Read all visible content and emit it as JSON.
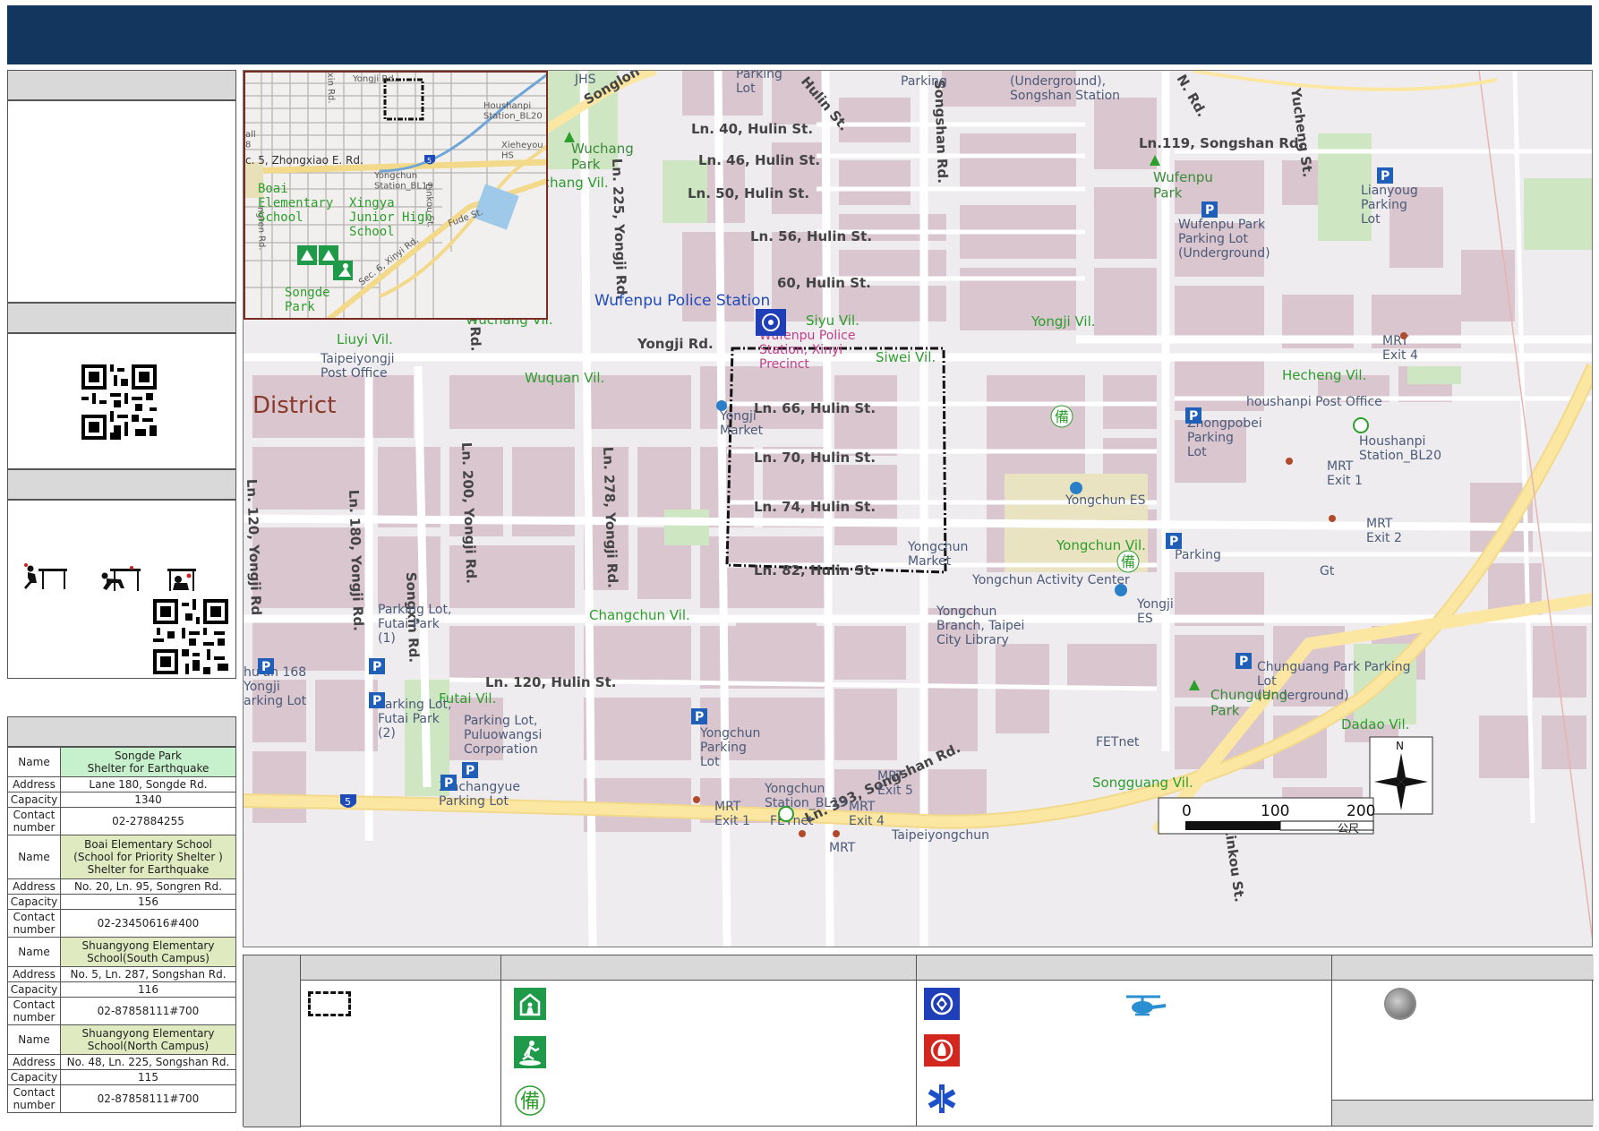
{
  "header": {
    "title": ""
  },
  "shelters": [
    {
      "name_label": "Name",
      "name": "Songde Park\nShelter for Earthquake",
      "address_label": "Address",
      "address": "Lane 180, Songde Rd.",
      "capacity_label": "Capacity",
      "capacity": "1340",
      "contact_label": "Contact\nnumber",
      "contact": "02-27884255",
      "color": "#c7f0cc"
    },
    {
      "name_label": "Name",
      "name": "Boai Elementary School\n(School for Priority Shelter )\nShelter for Earthquake",
      "address_label": "Address",
      "address": "No. 20, Ln. 95, Songren Rd.",
      "capacity_label": "Capacity",
      "capacity": "156",
      "contact_label": "Contact\nnumber",
      "contact": "02-23450616#400",
      "color": "#dfeac0"
    },
    {
      "name_label": "Name",
      "name": "Shuangyong Elementary\nSchool(South Campus)",
      "address_label": "Address",
      "address": "No. 5, Ln. 287, Songshan Rd.",
      "capacity_label": "Capacity",
      "capacity": "116",
      "contact_label": "Contact\nnumber",
      "contact": "02-87858111#700",
      "color": "#dfeac0"
    },
    {
      "name_label": "Name",
      "name": "Shuangyong Elementary\nSchool(North Campus)",
      "address_label": "Address",
      "address": "No. 48, Ln. 225, Songshan Rd.",
      "capacity_label": "Capacity",
      "capacity": "115",
      "contact_label": "Contact\nnumber",
      "contact": "02-87858111#700",
      "color": "#dfeac0"
    }
  ],
  "map": {
    "district_label": "District",
    "police_station": "Wufenpu Police Station",
    "precinct": "Wufenpu Police\nStation, Xinyi\nPrecinct",
    "roads": {
      "ln40": "Ln. 40, Hulin St.",
      "ln46": "Ln. 46, Hulin St.",
      "ln50": "Ln. 50, Hulin St.",
      "ln56": "Ln. 56, Hulin St.",
      "ln60": "60, Hulin St.",
      "ln66": "Ln. 66, Hulin St.",
      "ln70": "Ln. 70, Hulin St.",
      "ln74": "Ln. 74, Hulin St.",
      "ln82": "Ln. 82, Hulin St.",
      "ln120h": "Ln. 120, Hulin St.",
      "ln119": "Ln.119, Songshan Rd.",
      "ln393": "Ln. 393, Songshan Rd.",
      "yongji": "Yongji Rd.",
      "ln225": "Ln. 225, Yongji Rd.",
      "ln278": "Ln. 278, Yongji Rd.",
      "ln200": "Ln. 200, Yongji Rd.",
      "ln180": "Ln. 180, Yongji Rd.",
      "ln120y": "Ln. 120, Yongji Rd",
      "songxin": "Songxin Rd.",
      "songlong": "Songlon",
      "hulin": "Hulin St.",
      "yucheng": "Yucheng St.",
      "linkou": "Linkou St.",
      "nrd": "N. Rd.",
      "songshanrd": "Songshan Rd.",
      "shanrd": "shan Rd."
    },
    "villages": {
      "wuchang": "Wuchang Vil.",
      "wuchang2": "Wuchang Vil.",
      "siyu": "Siyu Vil.",
      "yongji": "Yongji Vil.",
      "liuyi": "Liuyi Vil.",
      "wuquan": "Wuquan Vil.",
      "siwei": "Siwei Vil.",
      "hecheng": "Hecheng Vil.",
      "yongchun": "Yongchun Vil.",
      "changchun": "Changchun Vil.",
      "futai": "Futai Vil.",
      "dadao": "Dadao Vil.",
      "songguang": "Songguang Vil."
    },
    "pois": {
      "jhs": "JHS",
      "parking_lot_top": "Parking\nLot",
      "parking_top": "Parking",
      "songshan_station": "(Underground),\nSongshan Station",
      "wuchang_park": "Wuchang\nPark",
      "wufenpu_park": "Wufenpu\nPark",
      "wufenpu_parking": "Wufenpu Park\nParking Lot\n(Underground)",
      "lianyoug": "Lianyoug\nParking\nLot",
      "mrt_exit4": "MRT\nExit 4",
      "post_office": "Taipeiyongji\nPost Office",
      "yongji_market": "Yongji\nMarket",
      "zhongpobei": "Zhongpobei\nParking\nLot",
      "houshanpi_post": "houshanpi Post Office",
      "houshanpi_station": "Houshanpi\nStation_BL20",
      "mrt_exit1": "MRT\nExit 1",
      "mrt_exit2": "MRT\nExit 2",
      "yongchun_es": "Yongchun ES",
      "parking_mid": "Parking",
      "yongchun_market": "Yongchun\nMarket",
      "activity_center": "Yongchun Activity Center",
      "library": "Yongchun\nBranch, Taipei\nCity Library",
      "yongji_es": "Yongji\nES",
      "gt": "Gt",
      "parking_futai1": "Parking Lot,\nFutai Park\n(1)",
      "parking_futai2": "Parking Lot,\nFutai Park\n(2)",
      "huan168": "hu'an 168\nYongji\narking Lot",
      "puluowangsi": "Parking Lot,\nPuluowangsi\nCorporation",
      "xinchangyue": "Xinchangyue\nParking Lot",
      "yongchun_parking": "Yongchun\nParking\nLot",
      "chunguang_parking": "Chunguang Park Parking\nLot\n(Underground)",
      "chunguang_park": "Chunguang\nPark",
      "fetnet": "FETnet",
      "fetnet2": "FETnet",
      "yongchun_station": "Yongchun\nStation_BL19",
      "mrt_exit5": "MRT\nExit 5",
      "mrt_exit4b": "MRT\nExit 4",
      "mrt_exit1b": "MRT\nExit 1",
      "mrt_bottom": "MRT",
      "taipeiyongchun": "Taipeiyongchun",
      "post_office_b": "Post Office"
    },
    "highway_number": "5",
    "north": "N",
    "scale": {
      "t0": "0",
      "t1": "100",
      "t2": "200",
      "unit": "公尺"
    },
    "icons": {
      "bei": "備"
    }
  },
  "inset": {
    "yongji_rd": "Yongji Rd.",
    "houshanpi": "Houshanpi\nStation_BL20",
    "xieheyou": "Xieheyou\nHS",
    "zhongxiao": "c. 5, Zhongxiao E. Rd.",
    "yongchun": "Yongchun\nStation_BL19",
    "boai": "Boai\nElementary\nSchool",
    "xingya": "Xingya\nJunior High\nSchool",
    "songde": "Songde\nPark",
    "xinyi": "Sec. 6, Xinyi Rd.",
    "fude": "Fude St.",
    "linkou": "Linkou St.",
    "kin": "xin Rd.",
    "songren": "ngren Rd.",
    "all": "all\n8",
    "highway": "5"
  },
  "legend": {
    "bei": "備"
  },
  "colors": {
    "header": "#12365e",
    "shelter_green": "#1e9a48",
    "police_blue": "#1f3fb8",
    "fire_red": "#d1271f",
    "ems_blue": "#1c4fc9",
    "heli_blue": "#2a8fd0",
    "village": "#2c9e2c",
    "road": "#fbe7a2"
  }
}
